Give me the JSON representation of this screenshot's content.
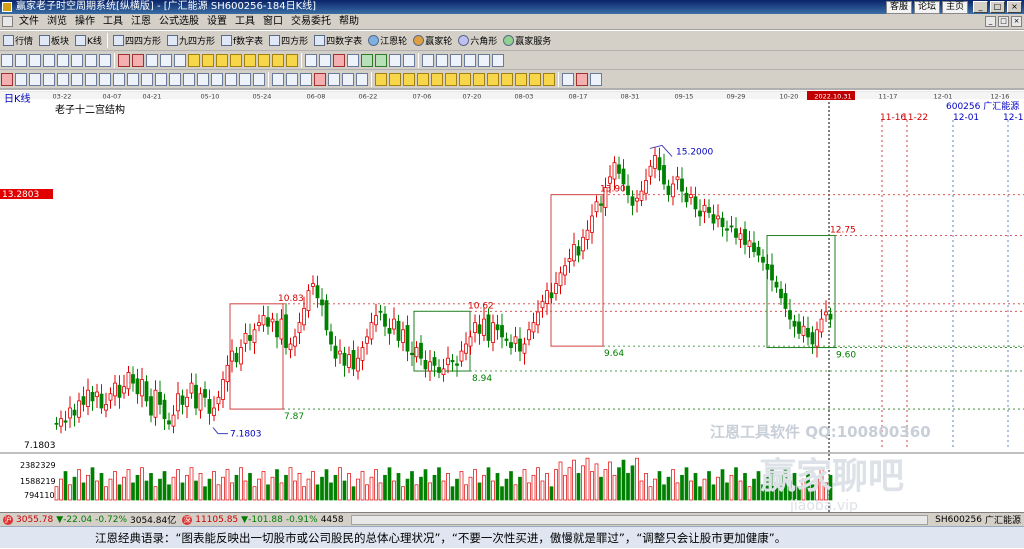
{
  "window": {
    "title": "赢家老子时空周期系统[纵横版] - [广汇能源  SH600256-184日K线]",
    "links": [
      "客服",
      "论坛",
      "主页"
    ]
  },
  "menu": [
    "文件",
    "浏览",
    "操作",
    "工具",
    "江恩",
    "公式选股",
    "设置",
    "工具",
    "窗口",
    "交易委托",
    "帮助"
  ],
  "toolbar1": [
    "行情",
    "板块",
    "K线",
    "四四方形",
    "九四方形",
    "f数字表",
    "四方形",
    "四数字表",
    "江恩轮",
    "赢家轮",
    "六角形",
    "赢家服务"
  ],
  "chart": {
    "period_label": "日K线",
    "structure_label": "老子十二宫结构",
    "stock_label": "600256 广汇能源",
    "date_ticks": [
      "03-22",
      "04-07",
      "04-21",
      "05-10",
      "05-24",
      "06-08",
      "06-22",
      "07-06",
      "07-20",
      "08-03",
      "08-17",
      "08-31",
      "09-15",
      "09-29",
      "10-20",
      "2022.10.31",
      "11-17",
      "12-01",
      "12-16"
    ],
    "future_dates": [
      "11-16",
      "11-22",
      "12-01",
      "12-1"
    ],
    "left_price_tag": "13.2803",
    "left_bottom_price": "7.1803",
    "price_labels": [
      "10.83",
      "7.87",
      "10.62",
      "8.94",
      "13.90",
      "9.64",
      "15.2000",
      "12.75",
      "9.60",
      "7.1803"
    ],
    "volume_axis": [
      "2382329",
      "1588219",
      "794110"
    ],
    "watermark1": "江恩工具软件 QQ:100800360",
    "watermark2": "赢家聊吧",
    "watermark3": "jiaoba.vip"
  },
  "chart_data": {
    "type": "candlestick",
    "title": "老子十二宫结构",
    "symbol": "600256 广汇能源",
    "period": "日K线",
    "ylim": [
      7.0,
      16.0
    ],
    "marked_prices": {
      "high": 15.2,
      "low": 7.1803,
      "levels": [
        10.83,
        7.87,
        10.62,
        8.94,
        13.9,
        9.64,
        12.75,
        9.6
      ]
    },
    "closes": [
      7.45,
      7.6,
      7.5,
      7.9,
      7.7,
      8.1,
      8.0,
      8.4,
      8.1,
      8.35,
      7.9,
      8.0,
      8.3,
      8.6,
      8.2,
      8.5,
      8.9,
      8.6,
      8.3,
      8.7,
      8.1,
      7.7,
      8.4,
      8.0,
      7.6,
      7.45,
      7.7,
      8.3,
      8.0,
      8.2,
      8.6,
      7.9,
      8.3,
      8.2,
      7.75,
      7.9,
      8.2,
      8.7,
      9.1,
      9.5,
      9.2,
      9.6,
      10.0,
      9.8,
      10.1,
      10.3,
      10.5,
      10.2,
      10.4,
      9.9,
      10.4,
      9.6,
      9.7,
      9.9,
      10.3,
      10.7,
      11.2,
      11.4,
      11.0,
      10.8,
      10.1,
      9.7,
      9.3,
      9.5,
      9.1,
      9.4,
      9.0,
      9.3,
      9.6,
      9.9,
      10.3,
      10.5,
      10.6,
      10.2,
      10.0,
      10.4,
      9.8,
      10.1,
      9.5,
      9.4,
      9.6,
      9.3,
      9.0,
      9.2,
      9.1,
      8.9,
      9.0,
      9.3,
      9.2,
      9.1,
      9.5,
      9.7,
      9.9,
      10.3,
      10.0,
      10.4,
      9.8,
      10.3,
      10.1,
      9.9,
      9.8,
      9.6,
      9.9,
      9.5,
      9.7,
      10.1,
      10.3,
      10.6,
      10.9,
      11.2,
      11.0,
      11.4,
      11.7,
      11.9,
      12.1,
      12.5,
      12.2,
      12.7,
      12.9,
      13.3,
      13.7,
      13.6,
      14.1,
      14.4,
      14.8,
      14.5,
      14.2,
      13.9,
      13.6,
      13.8,
      14.0,
      14.3,
      14.7,
      15.0,
      14.6,
      14.2,
      13.9,
      14.2,
      14.4,
      14.0,
      13.7,
      13.9,
      13.5,
      13.3,
      13.6,
      13.4,
      13.1,
      13.3,
      13.0,
      12.9,
      13.0,
      12.7,
      12.8,
      12.5,
      12.6,
      12.3,
      12.2,
      12.0,
      11.8,
      11.5,
      11.3,
      11.0,
      10.7,
      10.4,
      10.2,
      10.0,
      10.2,
      9.9,
      9.7,
      10.1,
      10.4,
      10.6,
      10.4
    ]
  },
  "status": {
    "sh_index": "3055.78",
    "sh_change": "▼-22.04",
    "sh_pct": "-0.72%",
    "sh_amount": "3054.84亿",
    "sz_index": "11105.85",
    "sz_change": "▼-101.88",
    "sz_pct": "-0.91%",
    "sz_amount": "4458",
    "symbol": "SH600256",
    "name": "广汇能源"
  },
  "quote": "江恩经典语录：“图表能反映出一切股市或公司股民的总体心理状况”，“不要一次性买进，傲慢就是罪过”，“调整只会让股市更加健康”。",
  "colors": {
    "up": "#e00000",
    "down": "#008000",
    "box_green": "#008000",
    "price_tag": "#e00000"
  }
}
